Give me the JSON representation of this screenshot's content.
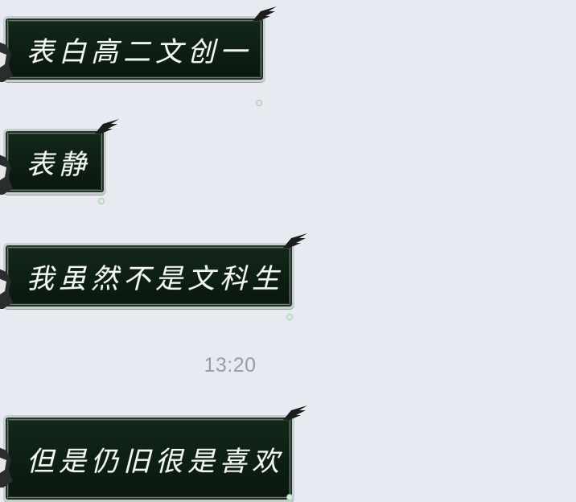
{
  "messages": [
    {
      "text": "表白高二文创一"
    },
    {
      "text": "表静"
    },
    {
      "text": "我虽然不是文科生"
    },
    {
      "text": "但是仍旧很是喜欢"
    }
  ],
  "timestamp": "13:20",
  "colors": {
    "background": "#e8eaf1",
    "bubble_fill": "#0d1e13",
    "bubble_border": "#c9cdd3",
    "bubble_text": "#f4f6f2",
    "timestamp_text": "#9a9ca1"
  },
  "icons": {
    "bubble_ornament": "wing-icon",
    "sender_avatar": "avatar"
  }
}
